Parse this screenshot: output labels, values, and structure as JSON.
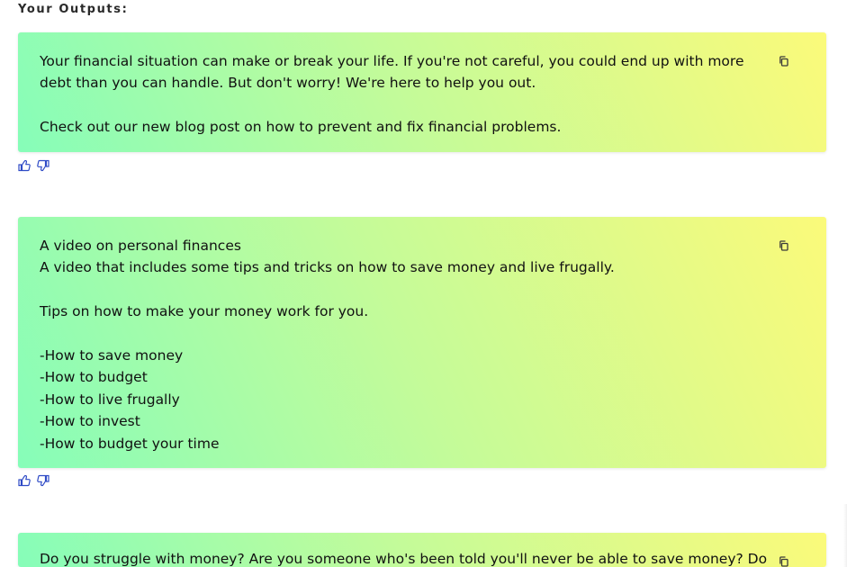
{
  "section": {
    "title": "Your Outputs:"
  },
  "outputs": [
    {
      "text": "Your financial situation can make or break your life. If you're not careful, you could end up with more debt than you can handle. But don't worry! We're here to help you out.\n\nCheck out our new blog post on how to prevent and fix financial problems.",
      "copy_icon": "copy-icon",
      "like_icon": "thumbs-up-icon",
      "dislike_icon": "thumbs-down-icon"
    },
    {
      "text": "A video on personal finances\nA video that includes some tips and tricks on how to save money and live frugally.\n\nTips on how to make your money work for you.\n\n-How to save money\n-How to budget\n-How to live frugally\n-How to invest\n-How to budget your time",
      "copy_icon": "copy-icon",
      "like_icon": "thumbs-up-icon",
      "dislike_icon": "thumbs-down-icon"
    },
    {
      "text": "Do you struggle with money? Are you someone who's been told you'll never be able to save money? Do",
      "copy_icon": "copy-icon"
    }
  ],
  "colors": {
    "gradient_start": "#86fdb9",
    "gradient_mid": "#c4fb99",
    "gradient_end": "#fbfa7a",
    "feedback_icon": "#2f4bc6",
    "text": "#111111"
  }
}
